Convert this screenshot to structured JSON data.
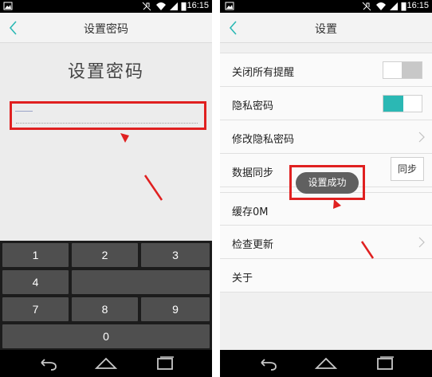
{
  "status_bar": {
    "time": "16:15"
  },
  "left_screen": {
    "header_title": "设置密码",
    "big_title": "设置密码",
    "keypad": {
      "keys": [
        {
          "label": "1"
        },
        {
          "label": "2"
        },
        {
          "label": "3"
        },
        {
          "label": "4"
        },
        {
          "label": ""
        },
        {
          "label": "7"
        },
        {
          "label": "8"
        },
        {
          "label": "9"
        },
        {
          "label": "0"
        }
      ]
    }
  },
  "right_screen": {
    "header_title": "设置",
    "rows": [
      {
        "label": "关闭所有提醒",
        "toggle": "off"
      },
      {
        "label": "隐私密码",
        "toggle": "on"
      },
      {
        "label": "修改隐私密码",
        "control": "chevron"
      },
      {
        "label": "数据同步",
        "button": "同步"
      },
      {
        "label": "缓存0M"
      },
      {
        "label": "检查更新",
        "control": "chevron"
      },
      {
        "label": "关于"
      }
    ],
    "toast": "设置成功"
  },
  "colors": {
    "accent": "#2bb8b4",
    "highlight_red": "#e02020",
    "key_bg": "#4f4f4f",
    "keypad_bg": "#1c1c1c"
  }
}
